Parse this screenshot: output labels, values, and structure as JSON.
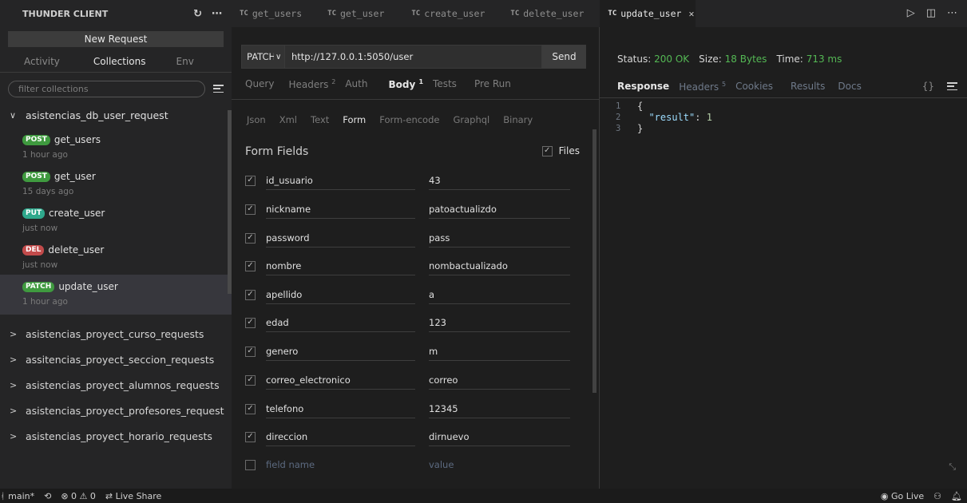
{
  "sidebar": {
    "title": "THUNDER CLIENT",
    "refresh_icon": "refresh-icon",
    "more_icon": "more-icon",
    "new_request_label": "New Request",
    "tabs": [
      {
        "label": "Activity"
      },
      {
        "label": "Collections"
      },
      {
        "label": "Env"
      }
    ],
    "filter_placeholder": "filter collections",
    "open_collection": "asistencias_db_user_request",
    "requests": [
      {
        "method": "POST",
        "name": "get_users",
        "time": "1 hour ago",
        "color": "#3f9a3f"
      },
      {
        "method": "POST",
        "name": "get_user",
        "time": "15 days ago",
        "color": "#3f9a3f"
      },
      {
        "method": "PUT",
        "name": "create_user",
        "time": "just now",
        "color": "#2fa88c"
      },
      {
        "method": "DEL",
        "name": "delete_user",
        "time": "just now",
        "color": "#c24b4b"
      },
      {
        "method": "PATCH",
        "name": "update_user",
        "time": "1 hour ago",
        "color": "#3f9a3f"
      }
    ],
    "collections": [
      "asistencias_proyect_curso_requests",
      "assitencias_proyect_seccion_requests",
      "asistencias_proyect_alumnos_requests",
      "asistencias_proyect_profesores_request",
      "asistencias_proyect_horario_requests"
    ]
  },
  "tabs": [
    {
      "badge": "TC",
      "label": "get_users"
    },
    {
      "badge": "TC",
      "label": "get_user"
    },
    {
      "badge": "TC",
      "label": "create_user"
    },
    {
      "badge": "TC",
      "label": "delete_user"
    },
    {
      "badge": "TC",
      "label": "update_user"
    }
  ],
  "request": {
    "method": "PATCH",
    "url": "http://127.0.0.1:5050/user",
    "send_label": "Send",
    "tabs": [
      {
        "label": "Query",
        "sup": ""
      },
      {
        "label": "Headers",
        "sup": "2"
      },
      {
        "label": "Auth",
        "sup": ""
      },
      {
        "label": "Body",
        "sup": "1"
      },
      {
        "label": "Tests",
        "sup": ""
      },
      {
        "label": "Pre Run",
        "sup": ""
      }
    ],
    "body_tabs": [
      "Json",
      "Xml",
      "Text",
      "Form",
      "Form-encode",
      "Graphql",
      "Binary"
    ],
    "form_title": "Form Fields",
    "files_label": "Files",
    "fields": [
      {
        "name": "id_usuario",
        "value": "43"
      },
      {
        "name": "nickname",
        "value": "patoactualizdo"
      },
      {
        "name": "password",
        "value": "pass"
      },
      {
        "name": "nombre",
        "value": "nombactualizado"
      },
      {
        "name": "apellido",
        "value": "a"
      },
      {
        "name": "edad",
        "value": "123"
      },
      {
        "name": "genero",
        "value": "m"
      },
      {
        "name": "correo_electronico",
        "value": "correo"
      },
      {
        "name": "telefono",
        "value": "12345"
      },
      {
        "name": "direccion",
        "value": "dirnuevo"
      }
    ],
    "new_field": {
      "name_placeholder": "field name",
      "value_placeholder": "value"
    }
  },
  "response": {
    "status_label": "Status:",
    "status_value": "200 OK",
    "size_label": "Size:",
    "size_value": "18 Bytes",
    "time_label": "Time:",
    "time_value": "713 ms",
    "tabs": [
      {
        "label": "Response",
        "sup": ""
      },
      {
        "label": "Headers",
        "sup": "5"
      },
      {
        "label": "Cookies",
        "sup": ""
      },
      {
        "label": "Results",
        "sup": ""
      },
      {
        "label": "Docs",
        "sup": ""
      }
    ],
    "braces_label": "{}",
    "lines": [
      {
        "n": "1",
        "t": "{"
      },
      {
        "n": "2",
        "key": "\"result\"",
        "sep": ": ",
        "val": "1"
      },
      {
        "n": "3",
        "t": "}"
      }
    ]
  },
  "statusbar": {
    "branch": "main*",
    "problems": "⊗ 0 ⚠ 0",
    "live_share": "Live Share",
    "go_live": "Go Live"
  }
}
